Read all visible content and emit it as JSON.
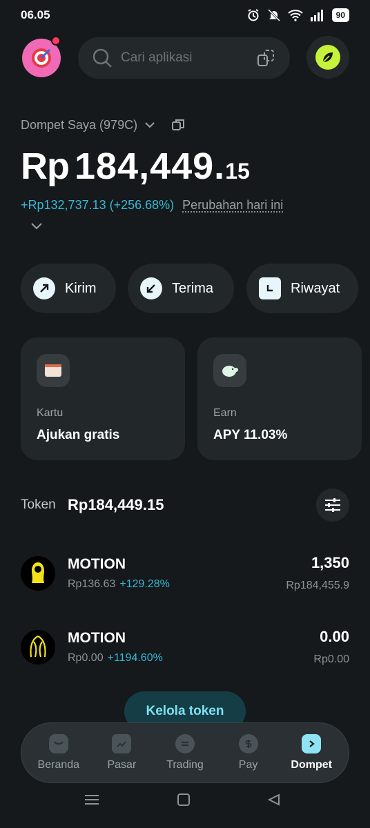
{
  "status": {
    "time": "06.05",
    "battery": "90"
  },
  "header": {
    "search_placeholder": "Cari aplikasi"
  },
  "wallet": {
    "name": "Dompet Saya (979C)",
    "balance_currency": "Rp",
    "balance_int": "184,449.",
    "balance_dec": "15",
    "change_value": "+Rp132,737.13 (+256.68%)",
    "change_label": "Perubahan hari ini"
  },
  "actions": [
    {
      "label": "Kirim",
      "icon": "arrow-up-right-icon"
    },
    {
      "label": "Terima",
      "icon": "arrow-down-left-icon"
    },
    {
      "label": "Riwayat",
      "icon": "history-icon"
    }
  ],
  "cards": [
    {
      "title": "Kartu",
      "value": "Ajukan gratis",
      "icon": "card-icon"
    },
    {
      "title": "Earn",
      "value": "APY 11.03%",
      "icon": "piggy-bank-icon"
    }
  ],
  "tokens": {
    "label": "Token",
    "total": "Rp184,449.15",
    "items": [
      {
        "name": "MOTION",
        "price": "Rp136.63",
        "change": "+129.28%",
        "amount": "1,350",
        "fiat": "Rp184,455.9"
      },
      {
        "name": "MOTION",
        "price": "Rp0.00",
        "change": "+1194.60%",
        "amount": "0.00",
        "fiat": "Rp0.00"
      }
    ],
    "manage_label": "Kelola token"
  },
  "nav": [
    {
      "label": "Beranda",
      "icon": "home-icon",
      "active": false
    },
    {
      "label": "Pasar",
      "icon": "market-icon",
      "active": false
    },
    {
      "label": "Trading",
      "icon": "trading-icon",
      "active": false
    },
    {
      "label": "Pay",
      "icon": "pay-icon",
      "active": false
    },
    {
      "label": "Dompet",
      "icon": "wallet-icon",
      "active": true
    }
  ],
  "colors": {
    "background": "#15191b",
    "accent": "#39b7d6",
    "brand": "#c7f23a"
  }
}
